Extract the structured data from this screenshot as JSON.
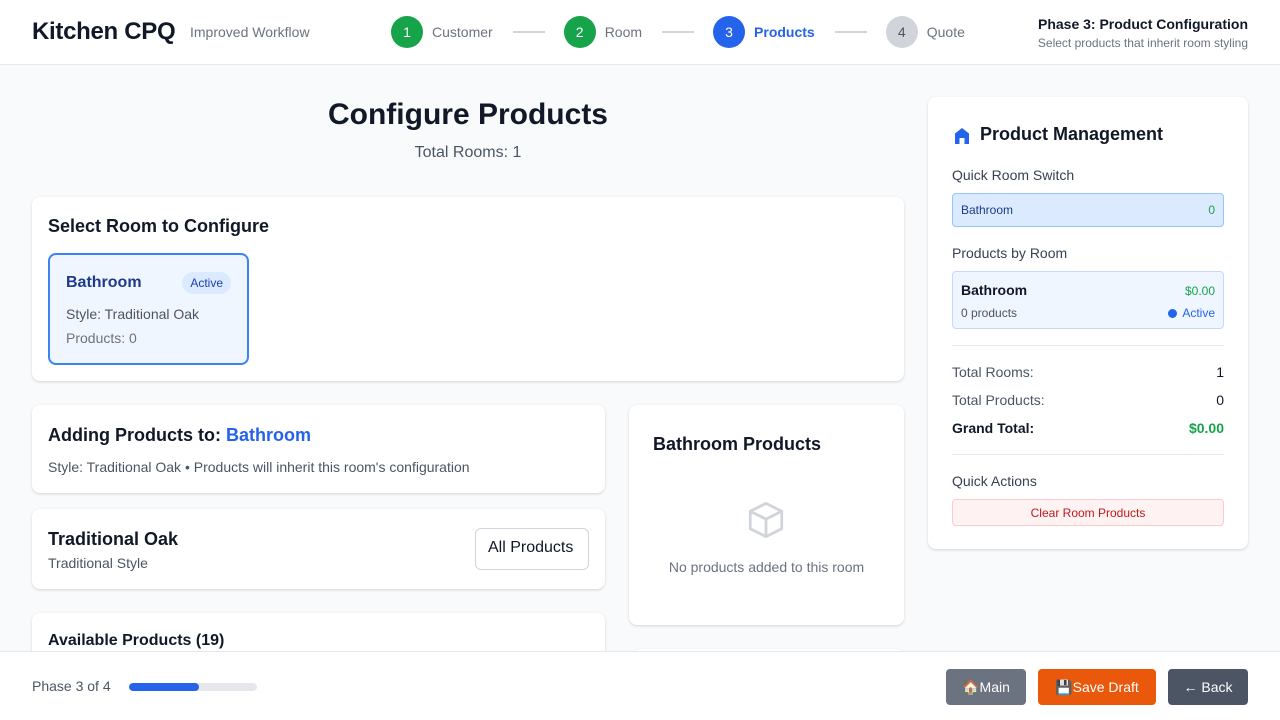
{
  "header": {
    "app_title": "Kitchen CPQ",
    "app_subtitle": "Improved Workflow",
    "steps": [
      {
        "number": "1",
        "label": "Customer",
        "state": "done"
      },
      {
        "number": "2",
        "label": "Room",
        "state": "done"
      },
      {
        "number": "3",
        "label": "Products",
        "state": "current"
      },
      {
        "number": "4",
        "label": "Quote",
        "state": "pending"
      }
    ],
    "phase_title": "Phase 3: Product Configuration",
    "phase_subtitle": "Select products that inherit room styling"
  },
  "main": {
    "title": "Configure Products",
    "subtitle": "Total Rooms: 1",
    "select_room": {
      "title": "Select Room to Configure",
      "rooms": [
        {
          "name": "Bathroom",
          "badge": "Active",
          "style": "Style: Traditional Oak",
          "products": "Products: 0"
        }
      ]
    },
    "adding": {
      "prefix": "Adding Products to: ",
      "room": "Bathroom",
      "subtitle": "Style: Traditional Oak • Products will inherit this room's configuration"
    },
    "style_panel": {
      "name": "Traditional Oak",
      "type": "Traditional Style",
      "filter_value": "All Products"
    },
    "available": {
      "title": "Available Products (19)"
    },
    "room_products": {
      "title": "Bathroom Products",
      "empty_text": "No products added to this room",
      "icon": "box-icon"
    }
  },
  "sidebar": {
    "title": "Product Management",
    "icon": "home-icon",
    "quick_switch_label": "Quick Room Switch",
    "quick_switch": [
      {
        "name": "Bathroom",
        "count": "0"
      }
    ],
    "by_room_label": "Products by Room",
    "by_room": [
      {
        "name": "Bathroom",
        "total": "$0.00",
        "count": "0 products",
        "status": "Active"
      }
    ],
    "stats": {
      "total_rooms_label": "Total Rooms:",
      "total_rooms": "1",
      "total_products_label": "Total Products:",
      "total_products": "0",
      "grand_total_label": "Grand Total:",
      "grand_total": "$0.00"
    },
    "quick_actions_label": "Quick Actions",
    "clear_button": "Clear Room Products"
  },
  "footer": {
    "phase_text": "Phase 3 of 4",
    "progress": 0.55,
    "main_button": "🏠Main",
    "save_button": "💾Save Draft",
    "back_button": "← Back"
  },
  "colors": {
    "primary": "#2563eb",
    "success": "#16a34a",
    "save": "#ea580c",
    "danger": "#b91c1c"
  }
}
